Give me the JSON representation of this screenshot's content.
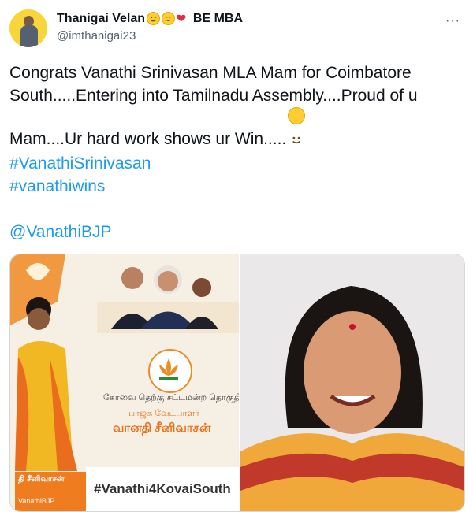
{
  "author": {
    "name": "Thanigai Velan",
    "name_suffix": "BE MBA",
    "handle": "@imthanigai23"
  },
  "tweet": {
    "text": "Congrats Vanathi Srinivasan MLA Mam for Coimbatore\nSouth.....Entering into Tamilnadu Assembly....Proud of u\nMam....Ur hard work shows ur Win.....",
    "hashtags": [
      "#VanathiSrinivasan",
      "#vanathiwins"
    ],
    "mention": "@VanathiBJP"
  },
  "media": {
    "poster": {
      "tamil_line1": "கோவை தெற்கு சட்டமன்ற தொகுதி",
      "tamil_line2": "பாஜக வேட்பாளர்",
      "tamil_name": "வானதி சீனிவாசன்",
      "hashtag": "#Vanathi4KovaiSouth",
      "left_caption": "தி சீனிவாசன்",
      "left_sub": "VanathiBJP"
    }
  },
  "icons": {
    "more": "more-options-icon",
    "smile": "smiling-face-icon",
    "heart_eyes": "heart-eyes-icon",
    "heart": "red-heart-icon"
  },
  "colors": {
    "link": "#1d9bf0",
    "text": "#0f1419",
    "secondary": "#536471",
    "saffron": "#f07c20"
  }
}
